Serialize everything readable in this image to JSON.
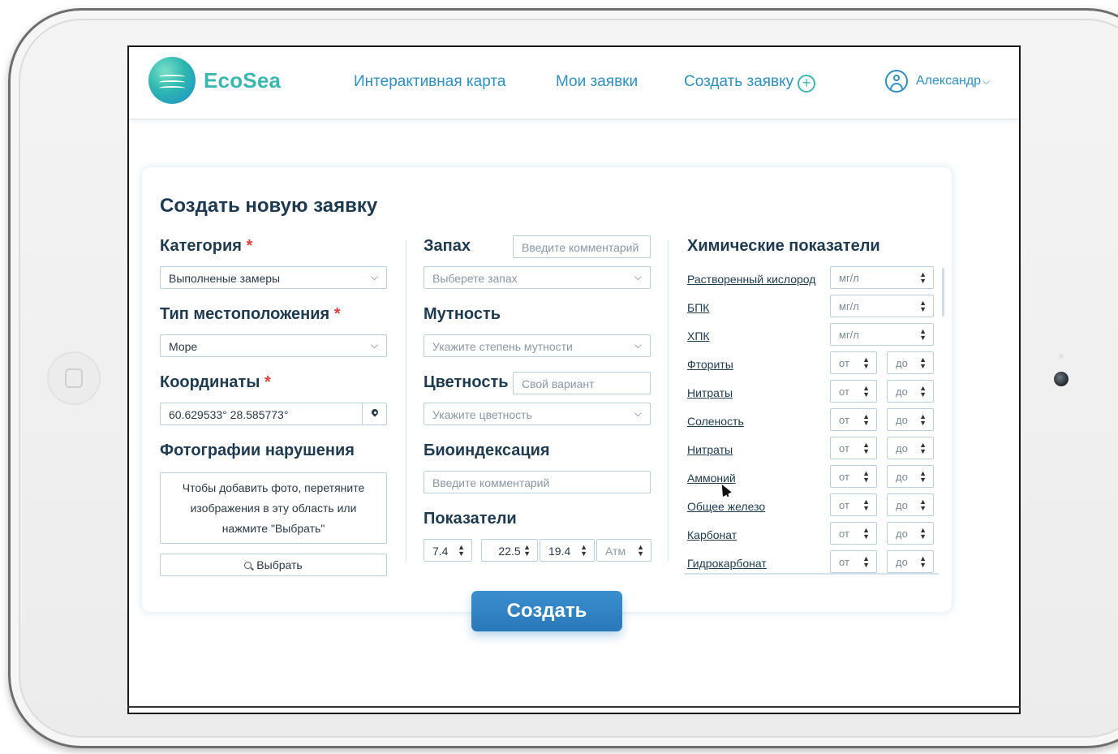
{
  "brand": {
    "name": "EcoSea"
  },
  "nav": {
    "map": "Интерактивная карта",
    "my_requests": "Мои заявки",
    "create": "Создать заявку",
    "plus": "+"
  },
  "user": {
    "name": "Александр",
    "chevron": "⌵"
  },
  "form": {
    "title": "Создать новую заявку",
    "category": {
      "label": "Категория",
      "star": "*",
      "value": "Выполненые замеры"
    },
    "location": {
      "label": "Тип местоположения",
      "star": "*",
      "value": "Море"
    },
    "coords": {
      "label": "Координаты",
      "star": "*",
      "value": "60.629533° 28.585773°"
    },
    "photos": {
      "label": "Фотографии нарушения",
      "drop_line1": "Чтобы добавить фото, перетяните",
      "drop_line2": "изображения в эту область или",
      "drop_line3": "нажмите \"Выбрать\"",
      "choose": "Выбрать"
    },
    "smell": {
      "label": "Запах",
      "comment_placeholder": "Введите комментарий",
      "select_placeholder": "Выберете запах"
    },
    "turbidity": {
      "label": "Мутность",
      "select_placeholder": "Укажите степень мутности"
    },
    "color": {
      "label": "Цветность",
      "variant_placeholder": "Свой вариант",
      "select_placeholder": "Укажите цветность"
    },
    "bioindex": {
      "label": "Биоиндексация",
      "placeholder": "Введите комментарий"
    },
    "indicators": {
      "label": "Показатели",
      "values": [
        "7.4",
        "22.5",
        "19.4",
        "Атм"
      ]
    },
    "chemistry": {
      "label": "Химические показатели",
      "unit_rows": [
        {
          "name": "Растворенный кислород",
          "unit": "мг/л"
        },
        {
          "name": "БПК",
          "unit": "мг/л"
        },
        {
          "name": "ХПК",
          "unit": "мг/л"
        }
      ],
      "range_rows": [
        {
          "name": "Фториты",
          "from": "от",
          "to": "до"
        },
        {
          "name": "Нитраты",
          "from": "от",
          "to": "до"
        },
        {
          "name": "Соленость",
          "from": "от",
          "to": "до"
        },
        {
          "name": "Нитраты",
          "from": "от",
          "to": "до"
        },
        {
          "name": "Аммоний",
          "from": "от",
          "to": "до"
        },
        {
          "name": "Общее железо",
          "from": "от",
          "to": "до"
        },
        {
          "name": "Карбонат",
          "from": "от",
          "to": "до"
        },
        {
          "name": "Гидрокарбонат",
          "from": "от",
          "to": "до"
        }
      ]
    },
    "submit": "Создать"
  },
  "icons": {
    "logo": "wave-logo-icon",
    "user": "user-circle-icon",
    "chevron": "chevron-down-icon",
    "pin": "map-pin-icon",
    "search": "search-icon",
    "spinner": "spinner-arrows-icon",
    "cursor": "mouse-cursor-icon"
  },
  "colors": {
    "brand_teal": "#3bb7b0",
    "link_blue": "#2f8fbf",
    "button_blue": "#2f82c4",
    "required_red": "#e0433a"
  }
}
